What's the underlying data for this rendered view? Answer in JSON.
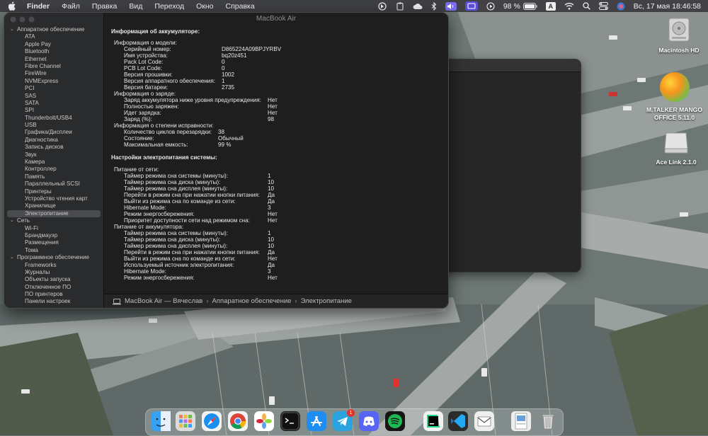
{
  "menubar": {
    "app": "Finder",
    "items": [
      "Файл",
      "Правка",
      "Вид",
      "Переход",
      "Окно",
      "Справка"
    ],
    "battery": "98 %",
    "input_source": "A",
    "clock": "Вс, 17 мая  18:46:58"
  },
  "window": {
    "title": "MacBook Air",
    "sidebar": [
      {
        "label": "Аппаратное обеспечение",
        "type": "group"
      },
      {
        "label": "ATA",
        "type": "item"
      },
      {
        "label": "Apple Pay",
        "type": "item"
      },
      {
        "label": "Bluetooth",
        "type": "item"
      },
      {
        "label": "Ethernet",
        "type": "item"
      },
      {
        "label": "Fibre Channel",
        "type": "item"
      },
      {
        "label": "FireWire",
        "type": "item"
      },
      {
        "label": "NVMExpress",
        "type": "item"
      },
      {
        "label": "PCI",
        "type": "item"
      },
      {
        "label": "SAS",
        "type": "item"
      },
      {
        "label": "SATA",
        "type": "item"
      },
      {
        "label": "SPI",
        "type": "item"
      },
      {
        "label": "Thunderbolt/USB4",
        "type": "item"
      },
      {
        "label": "USB",
        "type": "item"
      },
      {
        "label": "Графика/Дисплеи",
        "type": "item"
      },
      {
        "label": "Диагностика",
        "type": "item"
      },
      {
        "label": "Запись дисков",
        "type": "item"
      },
      {
        "label": "Звук",
        "type": "item"
      },
      {
        "label": "Камера",
        "type": "item"
      },
      {
        "label": "Контроллер",
        "type": "item"
      },
      {
        "label": "Память",
        "type": "item"
      },
      {
        "label": "Параллельный SCSI",
        "type": "item"
      },
      {
        "label": "Принтеры",
        "type": "item"
      },
      {
        "label": "Устройство чтения карт",
        "type": "item"
      },
      {
        "label": "Хранилище",
        "type": "item"
      },
      {
        "label": "Электропитание",
        "type": "item",
        "selected": true
      },
      {
        "label": "Сеть",
        "type": "group"
      },
      {
        "label": "Wi-Fi",
        "type": "item"
      },
      {
        "label": "Брандмауэр",
        "type": "item"
      },
      {
        "label": "Размещения",
        "type": "item"
      },
      {
        "label": "Тома",
        "type": "item"
      },
      {
        "label": "Программное обеспечение",
        "type": "group"
      },
      {
        "label": "Frameworks",
        "type": "item"
      },
      {
        "label": "Журналы",
        "type": "item"
      },
      {
        "label": "Объекты запуска",
        "type": "item"
      },
      {
        "label": "Отключенное ПО",
        "type": "item"
      },
      {
        "label": "ПО принтеров",
        "type": "item"
      },
      {
        "label": "Панели настроек",
        "type": "item"
      }
    ],
    "content": [
      {
        "kind": "title",
        "text": "Информация об аккумуляторе:"
      },
      {
        "kind": "gap"
      },
      {
        "kind": "sub",
        "text": "Информация о модели:"
      },
      {
        "kind": "kv",
        "label": "Серийный номер:",
        "value": "D865224A09BPJYRBV"
      },
      {
        "kind": "kv",
        "label": "Имя устройства:",
        "value": "bq20z451"
      },
      {
        "kind": "kv",
        "label": "Pack Lot Code:",
        "value": "0"
      },
      {
        "kind": "kv",
        "label": "PCB Lot Code:",
        "value": "0"
      },
      {
        "kind": "kv",
        "label": "Версия прошивки:",
        "value": "1002"
      },
      {
        "kind": "kv",
        "label": "Версия аппаратного обеспечения:",
        "value": "1"
      },
      {
        "kind": "kv",
        "label": "Версия батареи:",
        "value": "2735"
      },
      {
        "kind": "sub",
        "text": "Информация о заряде:"
      },
      {
        "kind": "kv2",
        "label": "Заряд аккумулятора ниже уровня предупреждения:",
        "value": "Нет"
      },
      {
        "kind": "kv2",
        "label": "Полностью заряжен:",
        "value": "Нет"
      },
      {
        "kind": "kv2",
        "label": "Идет зарядка:",
        "value": "Нет"
      },
      {
        "kind": "kv2",
        "label": "Заряд (%):",
        "value": "98"
      },
      {
        "kind": "sub",
        "text": "Информация о степени исправности:"
      },
      {
        "kind": "kv3",
        "label": "Количество циклов перезарядки:",
        "value": "38"
      },
      {
        "kind": "kv3",
        "label": "Состояние:",
        "value": "Обычный"
      },
      {
        "kind": "kv3",
        "label": "Максимальная емкость:",
        "value": "99 %"
      },
      {
        "kind": "gap"
      },
      {
        "kind": "title",
        "text": "Настройки электропитания системы:"
      },
      {
        "kind": "gap"
      },
      {
        "kind": "sub",
        "text": "Питание от сети:"
      },
      {
        "kind": "kv4",
        "label": "Таймер режима сна системы (минуты):",
        "value": "1"
      },
      {
        "kind": "kv4",
        "label": "Таймер режима сна диска (минуты):",
        "value": "10"
      },
      {
        "kind": "kv4",
        "label": "Таймер режима сна дисплея (минуты):",
        "value": "10"
      },
      {
        "kind": "kv4",
        "label": "Перейти в режим сна при нажатии кнопки питания:",
        "value": "Да"
      },
      {
        "kind": "kv4",
        "label": "Выйти из режима сна по команде из сети:",
        "value": "Да"
      },
      {
        "kind": "kv4",
        "label": "Hibernate Mode:",
        "value": "3"
      },
      {
        "kind": "kv4",
        "label": "Режим энергосбережения:",
        "value": "Нет"
      },
      {
        "kind": "kv4",
        "label": "Приоритет доступности сети над режимом сна:",
        "value": "Нет"
      },
      {
        "kind": "sub",
        "text": "Питание от аккумулятора:"
      },
      {
        "kind": "kv4",
        "label": "Таймер режима сна системы (минуты):",
        "value": "1"
      },
      {
        "kind": "kv4",
        "label": "Таймер режима сна диска (минуты):",
        "value": "10"
      },
      {
        "kind": "kv4",
        "label": "Таймер режима сна дисплея (минуты):",
        "value": "10"
      },
      {
        "kind": "kv4",
        "label": "Перейти в режим сна при нажатии кнопки питания:",
        "value": "Да"
      },
      {
        "kind": "kv4",
        "label": "Выйти из режима сна по команде из сети:",
        "value": "Нет"
      },
      {
        "kind": "kv4",
        "label": "Используемый источник электропитания:",
        "value": "Да"
      },
      {
        "kind": "kv4",
        "label": "Hibernate Mode:",
        "value": "3"
      },
      {
        "kind": "kv4",
        "label": "Режим энергосбережения:",
        "value": "Нет"
      }
    ],
    "path": [
      "MacBook Air — Вячеслав",
      "Аппаратное обеспечение",
      "Электропитание"
    ]
  },
  "desktop": {
    "icons": [
      {
        "name": "macintosh-hd",
        "label": "Macintosh HD"
      },
      {
        "name": "mango-office",
        "label": "M.TALKER MANGO OFFICE 5.11.0"
      },
      {
        "name": "ace-link",
        "label": "Ace Link 2.1.0"
      }
    ]
  },
  "dock": {
    "apps": [
      "finder",
      "launchpad",
      "safari",
      "chrome",
      "photos",
      "terminal",
      "app-store",
      "telegram",
      "discord",
      "spotify",
      "pycharm",
      "vscode",
      "mail",
      "preview",
      "trash"
    ],
    "telegram_badge": "1"
  },
  "colors": {
    "accent": "#4a4b4e",
    "window_bg": "#1e1e1e",
    "sidebar_bg": "#2a2b2d"
  }
}
